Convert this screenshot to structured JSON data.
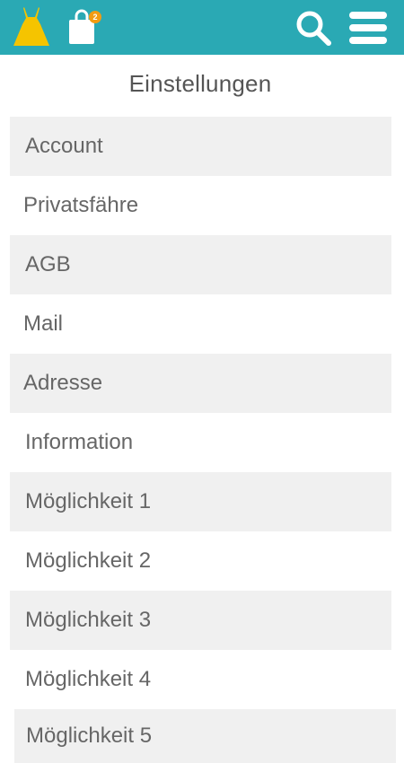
{
  "header": {
    "cart_count": "2",
    "colors": {
      "bar": "#2aa9b4",
      "logo": "#f5c400",
      "badge": "#f39c12"
    },
    "icons": [
      "dress-logo-icon",
      "shopping-bag-icon",
      "search-icon",
      "hamburger-menu-icon"
    ]
  },
  "page": {
    "title": "Einstellungen"
  },
  "settings": {
    "items": [
      {
        "label": "Account"
      },
      {
        "label": "Privatsfähre"
      },
      {
        "label": "AGB"
      },
      {
        "label": "Mail"
      },
      {
        "label": "Adresse"
      },
      {
        "label": "Information"
      },
      {
        "label": "Möglichkeit 1"
      },
      {
        "label": "Möglichkeit 2"
      },
      {
        "label": "Möglichkeit 3"
      },
      {
        "label": "Möglichkeit 4"
      },
      {
        "label": "Möglichkeit 5"
      }
    ]
  }
}
